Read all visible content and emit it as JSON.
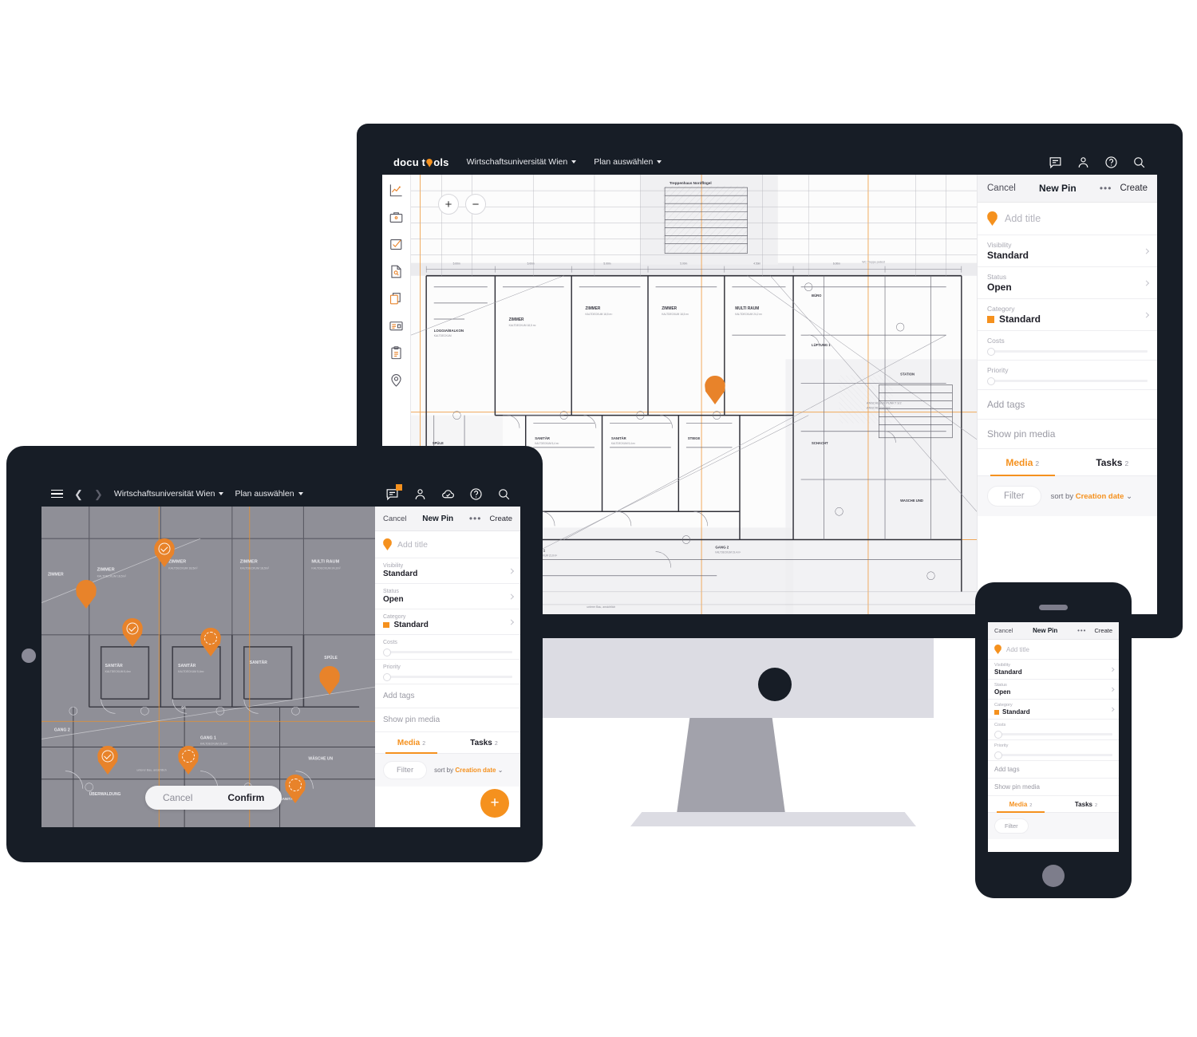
{
  "brand": {
    "name_part1": "docu t",
    "name_part2": "ols",
    "accent": "#F5911E",
    "dark": "#171d26"
  },
  "header": {
    "project": "Wirtschaftsuniversität Wien",
    "plan_select": "Plan auswählen",
    "icons": [
      "chat-icon",
      "user-icon",
      "help-icon",
      "search-icon"
    ]
  },
  "tablet_header": {
    "project": "Wirtschaftsuniversität Wien",
    "plan_select": "Plan auswählen",
    "icons": [
      "menu-icon",
      "back-arrow-icon",
      "forward-arrow-icon",
      "chat-icon",
      "user-icon",
      "cloud-check-icon",
      "help-icon",
      "search-icon"
    ]
  },
  "sidebar": {
    "items": [
      {
        "icon": "chart-icon",
        "label": "Statistics"
      },
      {
        "icon": "briefcase-icon",
        "label": "Projects"
      },
      {
        "icon": "checkbox-icon",
        "label": "Tasks"
      },
      {
        "icon": "document-icon",
        "label": "Reports"
      },
      {
        "icon": "layers-icon",
        "label": "Plans"
      },
      {
        "icon": "card-icon",
        "label": "Forms"
      },
      {
        "icon": "clipboard-icon",
        "label": "Protocols"
      },
      {
        "icon": "pin-icon",
        "label": "Pins"
      }
    ]
  },
  "plan_controls": {
    "zoom_in": "+",
    "zoom_out": "−"
  },
  "panel": {
    "cancel": "Cancel",
    "title": "New Pin",
    "more": "•••",
    "create": "Create",
    "add_title_placeholder": "Add title",
    "fields": [
      {
        "label": "Visibility",
        "value": "Standard"
      },
      {
        "label": "Status",
        "value": "Open"
      },
      {
        "label": "Category",
        "value": "Standard",
        "swatch": "#F5911E"
      }
    ],
    "sliders": [
      {
        "label": "Costs",
        "value": 0
      },
      {
        "label": "Priority",
        "value": 0
      }
    ],
    "links": [
      {
        "label": "Add tags"
      },
      {
        "label": "Show pin media"
      }
    ],
    "tabs": [
      {
        "label": "Media",
        "count": "2",
        "active": true
      },
      {
        "label": "Tasks",
        "count": "2",
        "active": false
      }
    ],
    "filter_label": "Filter",
    "sort_prefix": "sort by",
    "sort_value": "Creation date"
  },
  "tablet_actions": {
    "cancel": "Cancel",
    "confirm": "Confirm",
    "add_button": "+"
  }
}
